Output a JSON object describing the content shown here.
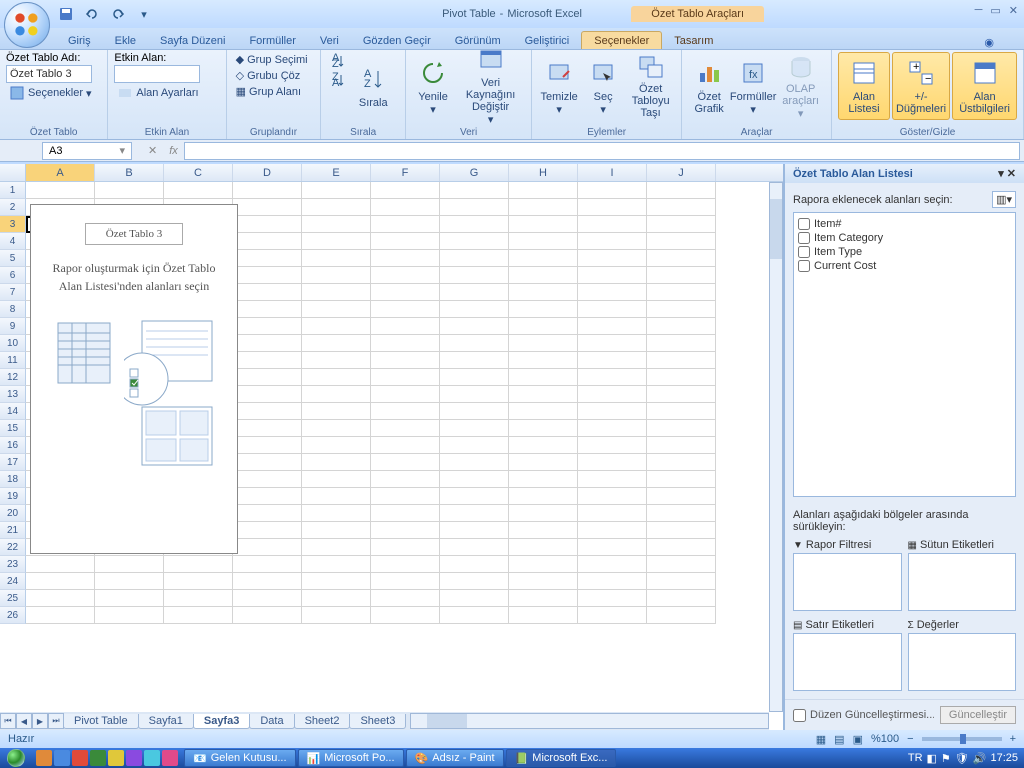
{
  "title": {
    "doc": "Pivot Table",
    "app": "Microsoft Excel",
    "contextual": "Özet Tablo Araçları"
  },
  "tabs": [
    "Giriş",
    "Ekle",
    "Sayfa Düzeni",
    "Formüller",
    "Veri",
    "Gözden Geçir",
    "Görünüm",
    "Geliştirici",
    "Seçenekler",
    "Tasarım"
  ],
  "active_tab": 8,
  "ribbon_groups": {
    "g0": {
      "label": "Özet Tablo",
      "name_label": "Özet Tablo Adı:",
      "name_value": "Özet Tablo 3",
      "options": "Seçenekler"
    },
    "g1": {
      "label": "Etkin Alan",
      "title": "Etkin Alan:",
      "settings": "Alan Ayarları"
    },
    "g2": {
      "label": "Gruplandır",
      "a": "Grup Seçimi",
      "b": "Grubu Çöz",
      "c": "Grup Alanı"
    },
    "g3": {
      "label": "Sırala",
      "sort": "Sırala"
    },
    "g4": {
      "label": "Veri",
      "refresh": "Yenile",
      "source": "Veri Kaynağını Değiştir"
    },
    "g5": {
      "label": "Eylemler",
      "clear": "Temizle",
      "select": "Seç",
      "move": "Özet Tabloyu Taşı"
    },
    "g6": {
      "label": "Araçlar",
      "chart": "Özet Grafik",
      "formulas": "Formüller",
      "olap": "OLAP araçları"
    },
    "g7": {
      "label": "Göster/Gizle",
      "fieldlist": "Alan Listesi",
      "pmbuttons": "+/- Düğmeleri",
      "headers": "Alan Üstbilgileri"
    }
  },
  "name_box": "A3",
  "fx_label": "fx",
  "columns": [
    "A",
    "B",
    "C",
    "D",
    "E",
    "F",
    "G",
    "H",
    "I",
    "J"
  ],
  "row_count": 26,
  "active_cell": {
    "row": 3,
    "col": 0
  },
  "pivot_placeholder": {
    "title": "Özet Tablo 3",
    "msg": "Rapor oluşturmak için Özet Tablo Alan Listesi'nden alanları seçin"
  },
  "sheet_tabs": [
    "Pivot Table",
    "Sayfa1",
    "Sayfa3",
    "Data",
    "Sheet2",
    "Sheet3"
  ],
  "active_sheet": 2,
  "field_pane": {
    "title": "Özet Tablo Alan Listesi",
    "choose": "Rapora eklenecek alanları seçin:",
    "fields": [
      "Item#",
      "Item Category",
      "Item Type",
      "Current Cost"
    ],
    "drag": "Alanları aşağıdaki bölgeler arasında sürükleyin:",
    "areas": {
      "filter": "Rapor Filtresi",
      "cols": "Sütun Etiketleri",
      "rows": "Satır Etiketleri",
      "vals": "Değerler"
    },
    "defer": "Düzen Güncelleştirmesi...",
    "update": "Güncelleştir"
  },
  "status": {
    "ready": "Hazır",
    "zoom": "%100"
  },
  "taskbar": {
    "items": [
      "Gelen Kutusu...",
      "Microsoft Po...",
      "Adsız - Paint",
      "Microsoft Exc..."
    ],
    "lang": "TR",
    "time": "17:25"
  }
}
